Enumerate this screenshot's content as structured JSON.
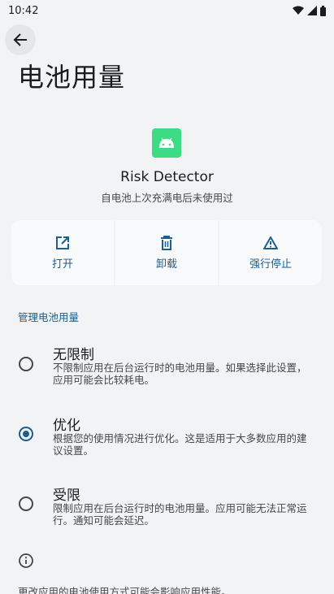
{
  "status_bar": {
    "time": "10:42"
  },
  "page": {
    "title": "电池用量"
  },
  "app": {
    "name": "Risk Detector",
    "subtitle": "自电池上次充满电后未使用过"
  },
  "actions": [
    {
      "label": "打开",
      "icon": "open-external-icon"
    },
    {
      "label": "卸载",
      "icon": "trash-icon"
    },
    {
      "label": "强行停止",
      "icon": "warning-icon"
    }
  ],
  "section": {
    "header": "管理电池用量"
  },
  "options": [
    {
      "title": "无限制",
      "desc": "不限制应用在后台运行时的电池用量。如果选择此设置，应用可能会比较耗电。",
      "checked": false
    },
    {
      "title": "优化",
      "desc": "根据您的使用情况进行优化。这是适用于大多数应用的建议设置。",
      "checked": true
    },
    {
      "title": "受限",
      "desc": "限制应用在后台运行时的电池用量。应用可能无法正常运行。通知可能会延迟。",
      "checked": false
    }
  ],
  "footer": {
    "text": "更改应用的电池使用方式可能会影响应用性能。"
  },
  "colors": {
    "accent": "#1a5f8e",
    "background": "#f2f3f5",
    "app_icon": "#3ddc84"
  }
}
